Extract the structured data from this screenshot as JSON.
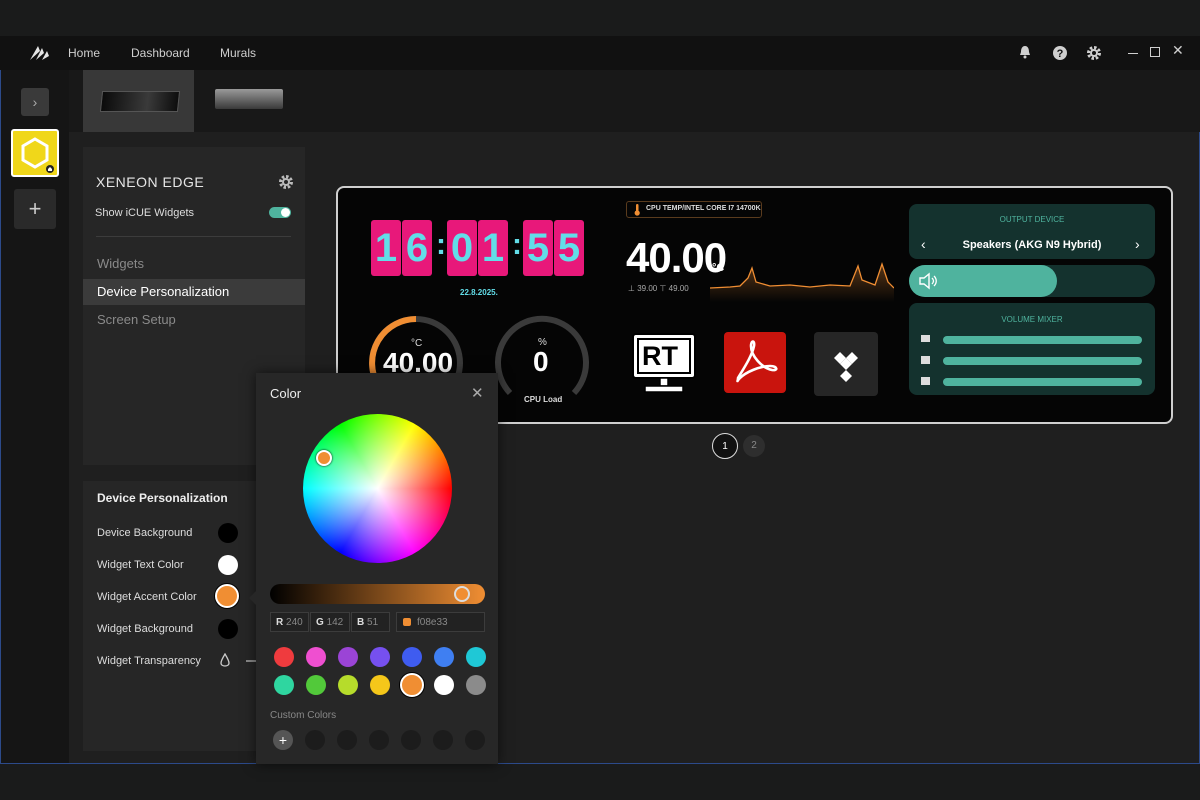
{
  "nav": {
    "home": "Home",
    "dashboard": "Dashboard",
    "murals": "Murals"
  },
  "title_icons": [
    "bell-icon",
    "help-icon",
    "gear-icon",
    "minimize-icon",
    "maximize-icon",
    "close-icon"
  ],
  "rail": {
    "expand_glyph": "›",
    "add_glyph": "+"
  },
  "panel": {
    "title": "XENEON EDGE",
    "show_widgets_label": "Show iCUE Widgets",
    "show_widgets_on": true,
    "menu": [
      "Widgets",
      "Device Personalization",
      "Screen Setup"
    ],
    "active_menu": "Device Personalization"
  },
  "personalization": {
    "title": "Device Personalization",
    "rows": [
      {
        "label": "Device Background",
        "color": "#000000"
      },
      {
        "label": "Widget Text Color",
        "color": "#ffffff"
      },
      {
        "label": "Widget Accent Color",
        "color": "#f08e33"
      },
      {
        "label": "Widget Background",
        "color": "#000000"
      },
      {
        "label": "Widget Transparency",
        "color": ""
      }
    ]
  },
  "preview": {
    "clock": {
      "d1": "1",
      "d2": "6",
      "d3": "0",
      "d4": "1",
      "d5": "5",
      "d6": "5",
      "sep": ":",
      "date": "22.8.2025."
    },
    "cpu_temp": {
      "label": "CPU TEMP/INTEL CORE I7 14700K",
      "value": "40.00",
      "unit": "°C",
      "min": "39.00",
      "max": "49.00"
    },
    "gauge_temp": {
      "unit": "°C",
      "value": "40.00"
    },
    "gauge_load": {
      "unit": "%",
      "value": "0",
      "label": "CPU Load"
    },
    "apps": {
      "rt": "RT"
    },
    "output": {
      "label": "OUTPUT DEVICE",
      "device": "Speakers (AKG N9 Hybrid)",
      "volume_fraction": 0.6
    },
    "mixer": {
      "label": "VOLUME MIXER"
    },
    "pages": [
      "1",
      "2"
    ]
  },
  "picker": {
    "title": "Color",
    "r_label": "R",
    "r": "240",
    "g_label": "G",
    "g": "142",
    "b_label": "B",
    "b": "51",
    "hex": "f08e33",
    "custom_label": "Custom Colors",
    "presets": [
      "#ef3b3e",
      "#ef4fd0",
      "#9b44d6",
      "#7650ef",
      "#3f5cf0",
      "#3f7ff2",
      "#1fc8d6",
      "#2fd6a0",
      "#52c93a",
      "#b6dc2b",
      "#f5c71a",
      "#f08e33",
      "#ffffff",
      "#8b8b8b"
    ],
    "selected_preset": 11
  },
  "colors": {
    "accent": "#f08e33",
    "clock_bg": "#e8187a",
    "clock_fg": "#62dde8",
    "teal": "#4fb39e"
  }
}
